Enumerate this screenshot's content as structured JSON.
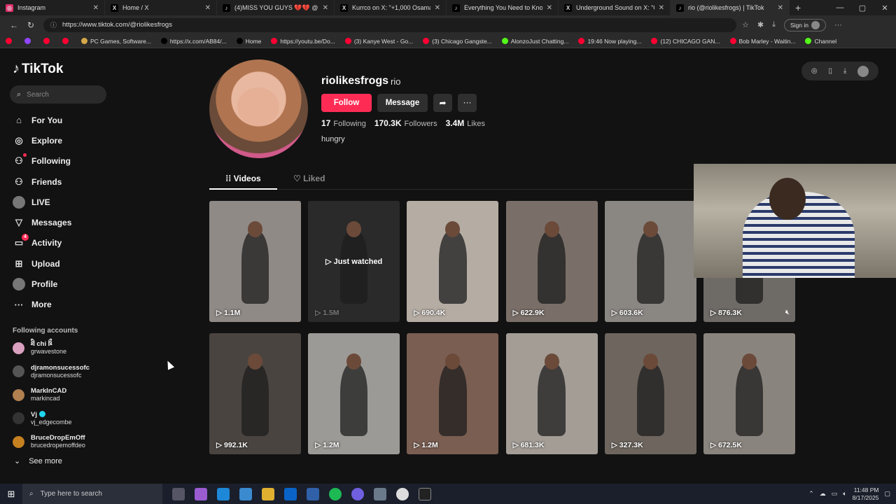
{
  "browser": {
    "tabs": [
      {
        "title": "Instagram",
        "color": "#e1306c",
        "glyph": "◎"
      },
      {
        "title": "Home / X",
        "color": "#000000",
        "glyph": "X"
      },
      {
        "title": "(4)MISS YOU GUYS 💔💔 @Dar",
        "color": "#000000",
        "glyph": "♪"
      },
      {
        "title": "Kurrco on X: \"+1,000 OsamaSon",
        "color": "#000000",
        "glyph": "X"
      },
      {
        "title": "Everything You Need to Know Ab",
        "color": "#000000",
        "glyph": "♪"
      },
      {
        "title": "Underground Sound on X: \"Osam",
        "color": "#000000",
        "glyph": "X"
      },
      {
        "title": "rio (@riolikesfrogs) | TikTok",
        "color": "#000000",
        "glyph": "♪"
      }
    ],
    "url": "https://www.tiktok.com/@riolikesfrogs",
    "signin": "Sign in",
    "bookmarks": [
      {
        "label": "",
        "color": "#ff0033"
      },
      {
        "label": "",
        "color": "#9146ff"
      },
      {
        "label": "",
        "color": "#ff0033"
      },
      {
        "label": "",
        "color": "#ff0033"
      },
      {
        "label": "PC Games, Software...",
        "color": "#d4a84a"
      },
      {
        "label": "https://x.com/AB84/...",
        "color": "#000000"
      },
      {
        "label": "Home",
        "color": "#000000"
      },
      {
        "label": "https://youtu.be/Do...",
        "color": "#ff0033"
      },
      {
        "label": "(3) Kanye West - Go...",
        "color": "#ff0033"
      },
      {
        "label": "(3) Chicago Gangste...",
        "color": "#ff0033"
      },
      {
        "label": "AlonzoJust Chatting...",
        "color": "#53fc18"
      },
      {
        "label": "19:46 Now playing...",
        "color": "#ff0033"
      },
      {
        "label": "(12) CHICAGO GAN...",
        "color": "#ff0033"
      },
      {
        "label": "Bob Marley - Waitin...",
        "color": "#ff0033"
      },
      {
        "label": "Channel",
        "color": "#53fc18"
      }
    ]
  },
  "sidebar": {
    "logo": "TikTok",
    "search_placeholder": "Search",
    "nav": [
      {
        "label": "For You",
        "icon": "⌂"
      },
      {
        "label": "Explore",
        "icon": "◎"
      },
      {
        "label": "Following",
        "icon": "⚇"
      },
      {
        "label": "Friends",
        "icon": "⚇"
      },
      {
        "label": "LIVE",
        "icon": ""
      },
      {
        "label": "Messages",
        "icon": "▽"
      },
      {
        "label": "Activity",
        "icon": "▭",
        "badge": "4"
      },
      {
        "label": "Upload",
        "icon": "⊞"
      },
      {
        "label": "Profile",
        "icon": ""
      },
      {
        "label": "More",
        "icon": "···"
      }
    ],
    "following_header": "Following accounts",
    "following": [
      {
        "name": "ཐི chi ཋྀ",
        "user": "grwavestone",
        "color": "#d9a0c0"
      },
      {
        "name": "djramonsucessofc",
        "user": "djramonsucessofc",
        "color": "#555555"
      },
      {
        "name": "MarkInCAD",
        "user": "markincad",
        "color": "#b08050"
      },
      {
        "name": "Vj",
        "user": "vj_edgecombe",
        "color": "#333333",
        "verified": true
      },
      {
        "name": "BruceDropEmOff",
        "user": "brucedropemoffdeo",
        "color": "#c58020"
      }
    ],
    "see_more": "See more"
  },
  "profile": {
    "username": "riolikesfrogs",
    "display_name": "rio",
    "follow": "Follow",
    "message": "Message",
    "following_count": "17",
    "following_label": "Following",
    "followers_count": "170.3K",
    "followers_label": "Followers",
    "likes_count": "3.4M",
    "likes_label": "Likes",
    "bio": "hungry"
  },
  "tabs": {
    "videos": "Videos",
    "liked": "Liked"
  },
  "videos": [
    {
      "views": "1.1M",
      "bg": "#8f8a86"
    },
    {
      "views": "1.5M",
      "bg": "#2a2a2a",
      "just_watched": "Just watched"
    },
    {
      "views": "690.4K",
      "bg": "#b5aca3"
    },
    {
      "views": "622.9K",
      "bg": "#7a6f68"
    },
    {
      "views": "603.6K",
      "bg": "#8a8682"
    },
    {
      "views": "876.3K",
      "bg": "#6e6a66"
    },
    {
      "views": "992.1K",
      "bg": "#4a4440"
    },
    {
      "views": "1.2M",
      "bg": "#9c9a96"
    },
    {
      "views": "1.2M",
      "bg": "#7a5e52"
    },
    {
      "views": "681.3K",
      "bg": "#a39d96"
    },
    {
      "views": "327.3K",
      "bg": "#6e665e"
    },
    {
      "views": "672.5K",
      "bg": "#8a847e"
    }
  ],
  "taskbar": {
    "search": "Type here to search",
    "time": "11:48 PM",
    "date": "8/17/2025"
  }
}
